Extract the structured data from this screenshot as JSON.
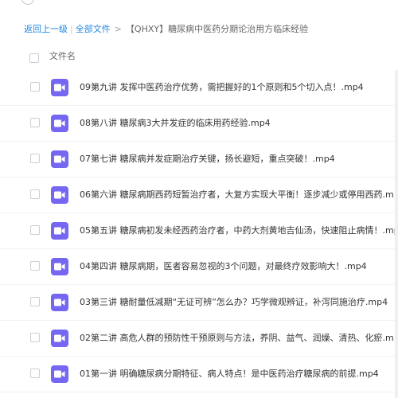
{
  "breadcrumb": {
    "back_label": "返回上一级",
    "separator": "|",
    "all_files_label": "全部文件",
    "arrow": ">",
    "current_folder": "【QHXY】糖尿病中医药分期论治用方临床经验"
  },
  "table": {
    "column_name": "文件名"
  },
  "files": [
    {
      "name": "09第九讲 发挥中医药治疗优势，需把握好的1个原则和5个切入点！.mp4",
      "icon": "video-file-icon"
    },
    {
      "name": "08第八讲 糖尿病3大并发症的临床用药经验.mp4",
      "icon": "video-file-icon"
    },
    {
      "name": "07第七讲 糖尿病并发症期治疗关键，扬长避短，重点突破！.mp4",
      "icon": "video-file-icon"
    },
    {
      "name": "06第六讲 糖尿病期西药短暂治疗者，大复方实现大平衡！逐步减少或停用西药.m",
      "icon": "video-file-icon"
    },
    {
      "name": "05第五讲 糖尿病初发未经西药治疗者，中药大剂黄地吉仙汤，快速阻止病情！.mp",
      "icon": "video-file-icon"
    },
    {
      "name": "04第四讲 糖尿病期，医者容易忽视的3个问题，对最终疗效影响大！.mp4",
      "icon": "video-file-icon"
    },
    {
      "name": "03第三讲 糖耐量低减期“无证可辨”怎么办？巧学微观辨证，补泻同施治疗.mp4",
      "icon": "video-file-icon"
    },
    {
      "name": "02第二讲 高危人群的预防性干预原则与方法，养阴、益气、润燥、清热、化瘀.m",
      "icon": "video-file-icon"
    },
    {
      "name": "01第一讲 明确糖尿病分期特征、病人特点！是中医药治疗糖尿病的前提.mp4",
      "icon": "video-file-icon"
    }
  ],
  "colors": {
    "accent": "#1e88e5",
    "video_icon": "#7567f1"
  }
}
